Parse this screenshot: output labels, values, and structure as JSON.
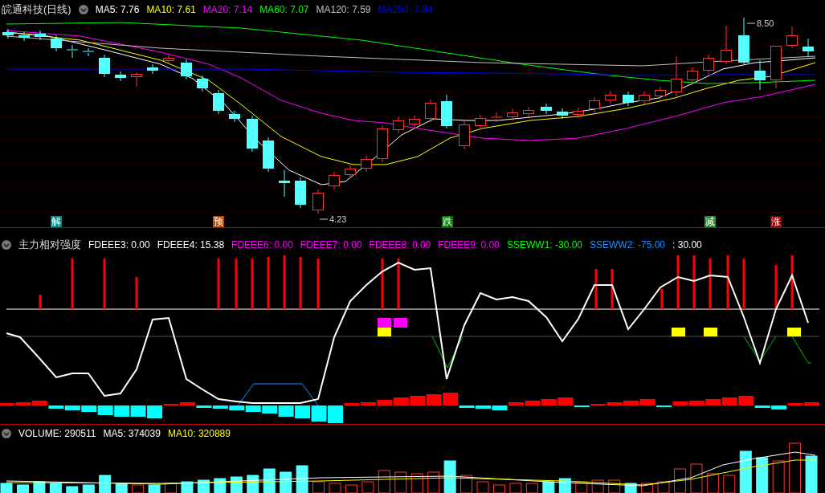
{
  "main_panel": {
    "title": "皖通科技(日线)",
    "legend": [
      {
        "text": "MA5: 7.76",
        "color": "#ffffff"
      },
      {
        "text": "MA10: 7.61",
        "color": "#ffff00"
      },
      {
        "text": "MA20: 7.14",
        "color": "#ff00ff"
      },
      {
        "text": "MA60: 7.07",
        "color": "#00ff00"
      },
      {
        "text": "MA120: 7.59",
        "color": "#c0c0c0"
      },
      {
        "text": "MA250: 7.34",
        "color": "#0000ff"
      }
    ],
    "price_marks": [
      "8.50",
      "4.23"
    ],
    "signals": [
      {
        "label": "解",
        "color": "#008b8b"
      },
      {
        "label": "预",
        "color": "#b84a00"
      },
      {
        "label": "跌",
        "color": "#008000"
      },
      {
        "label": "减",
        "color": "#2e8b2e"
      },
      {
        "label": "涨",
        "color": "#8b0000"
      }
    ]
  },
  "indicator_panel": {
    "title": "主力相对强度",
    "legend": [
      {
        "text": "FDEEE3: 0.00",
        "color": "#ffffff"
      },
      {
        "text": "FDEEE4: 15.38",
        "color": "#ffffff"
      },
      {
        "text": "FDEEE6: 0.00",
        "color": "#ff00ff"
      },
      {
        "text": "FDEEE7: 0.00",
        "color": "#ff00ff"
      },
      {
        "text": "FDEEE8: 0.00",
        "color": "#ff00ff"
      },
      {
        "text": "FDEEE9: 0.00",
        "color": "#ff00ff"
      },
      {
        "text": "SSEWW1: -30.00",
        "color": "#00ff00"
      },
      {
        "text": "SSEWW2: -75.00",
        "color": "#1e90ff"
      },
      {
        "text": ": 30.00",
        "color": "#ffffff"
      }
    ]
  },
  "volume_panel": {
    "legend": [
      {
        "text": "VOLUME: 290511",
        "color": "#ffffff"
      },
      {
        "text": "MA5: 374039",
        "color": "#ffffff"
      },
      {
        "text": "MA10: 320889",
        "color": "#ffff00"
      }
    ]
  }
}
